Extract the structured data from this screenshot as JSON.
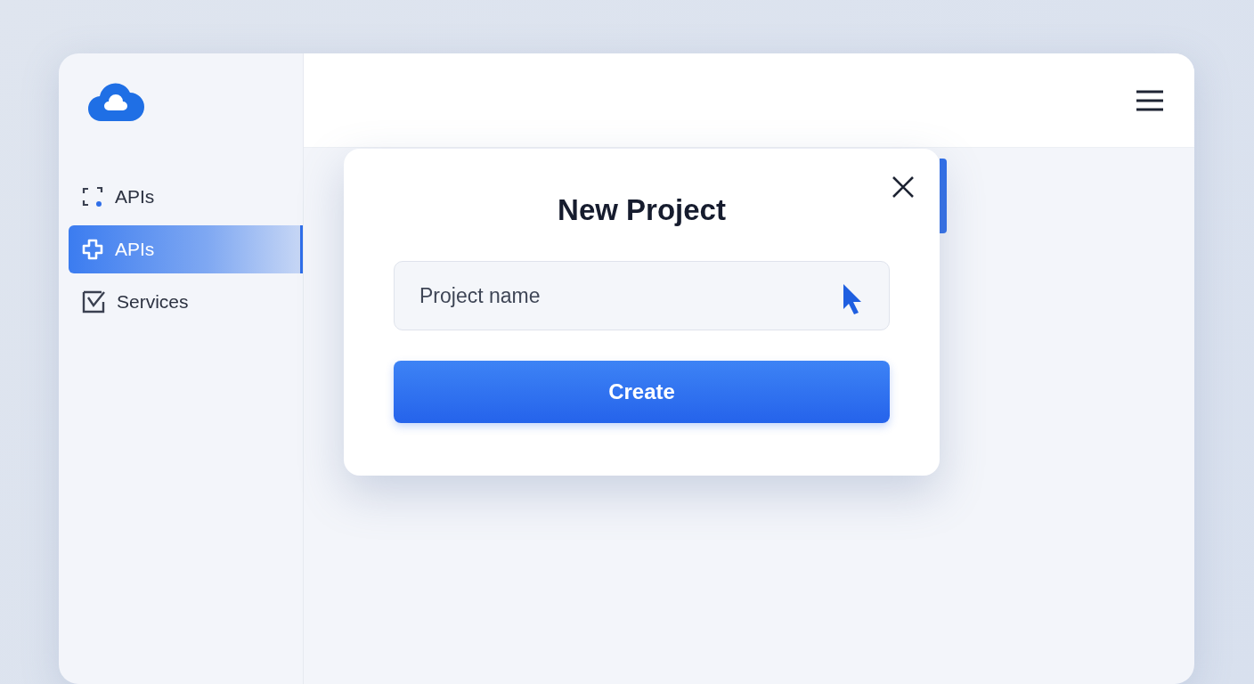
{
  "sidebar": {
    "items": [
      {
        "label": "APIs",
        "selected": false
      },
      {
        "label": "APIs",
        "selected": true
      },
      {
        "label": "Services",
        "selected": false
      }
    ]
  },
  "dialog": {
    "title": "New Project",
    "field": {
      "placeholder": "Project name"
    },
    "button": "Create"
  }
}
